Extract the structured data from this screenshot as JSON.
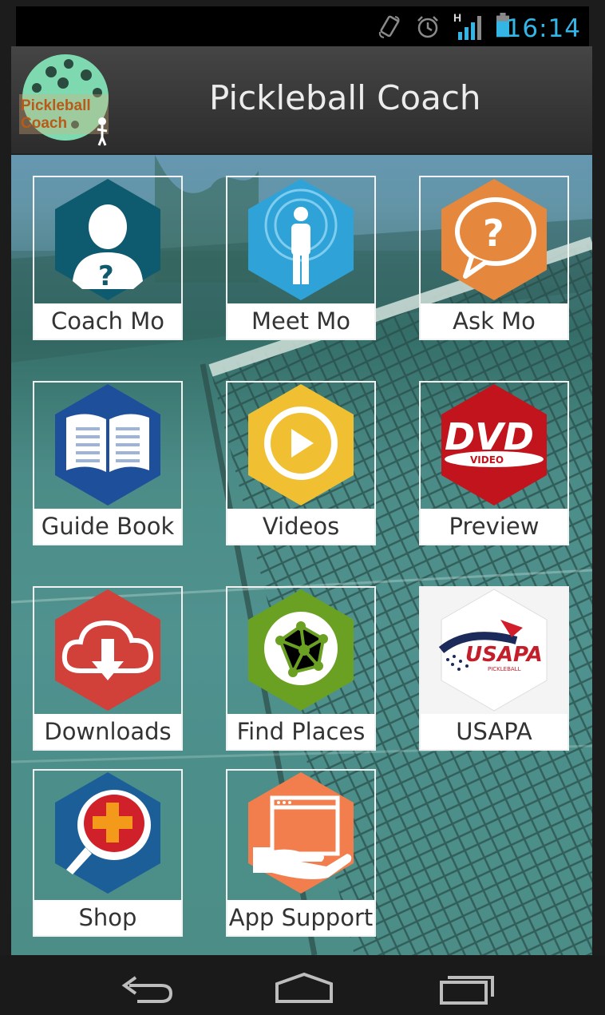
{
  "status_bar": {
    "time": "16:14",
    "icons": [
      "rotate-icon",
      "alarm-icon",
      "signal-h-icon",
      "battery-icon"
    ],
    "network_label": "H",
    "accent": "#33b5e5"
  },
  "action_bar": {
    "title": "Pickleball Coach",
    "logo_text_1": "Pickleball",
    "logo_text_2": "Coach"
  },
  "tiles": [
    {
      "label": "Coach Mo",
      "icon": "coach-question-icon",
      "color": "#0e5a6e"
    },
    {
      "label": "Meet Mo",
      "icon": "person-icon",
      "color": "#2fa3d8"
    },
    {
      "label": "Ask Mo",
      "icon": "question-bubble-icon",
      "color": "#e5883e"
    },
    {
      "label": "Guide Book",
      "icon": "book-icon",
      "color": "#1e4f9a"
    },
    {
      "label": "Videos",
      "icon": "play-icon",
      "color": "#f0c032"
    },
    {
      "label": "Preview",
      "icon": "dvd-icon",
      "color": "#c2141c",
      "text": "DVD",
      "subtext": "VIDEO"
    },
    {
      "label": "Downloads",
      "icon": "cloud-download-icon",
      "color": "#d2403a"
    },
    {
      "label": "Find Places",
      "icon": "network-icon",
      "color": "#6aa123"
    },
    {
      "label": "USAPA",
      "icon": "usapa-logo-icon",
      "color": "#ffffff",
      "text": "USAPA",
      "subtext": "PICKLEBALL"
    },
    {
      "label": "Shop",
      "icon": "shop-paddle-icon",
      "color": "#1c5f98"
    },
    {
      "label": "App Support",
      "icon": "support-hand-icon",
      "color": "#f27e4e"
    }
  ],
  "nav_bar": {
    "buttons": [
      "back-icon",
      "home-icon",
      "recents-icon"
    ]
  }
}
